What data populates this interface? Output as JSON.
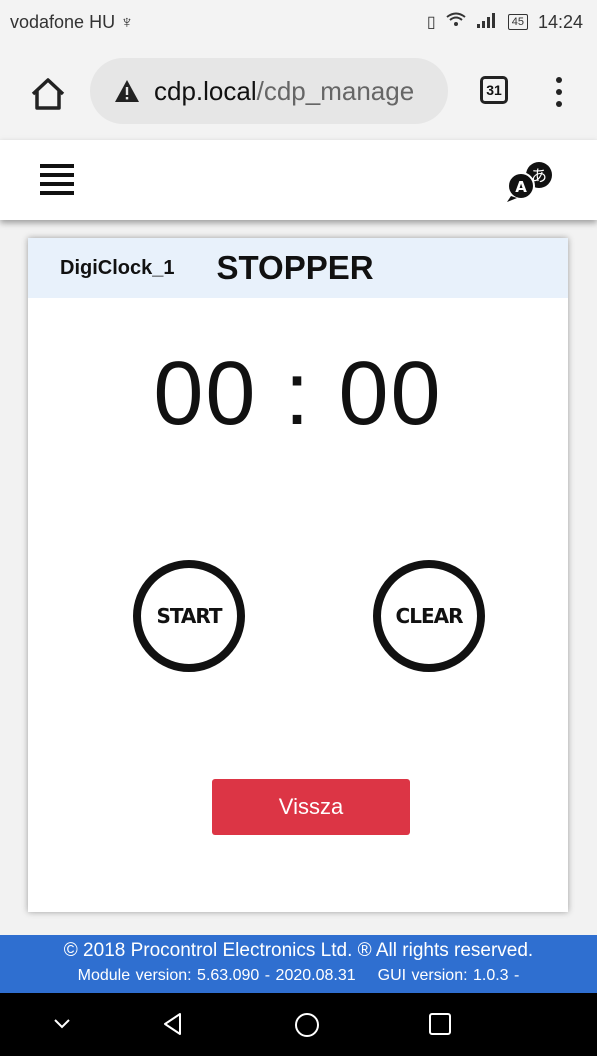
{
  "status_bar": {
    "carrier": "vodafone HU",
    "usb_icon": "usb-icon",
    "battery": "45",
    "time": "14:24"
  },
  "browser": {
    "url_host": "cdp.local",
    "url_path": "/cdp_manage",
    "tab_count": "31"
  },
  "app": {
    "menu_icon": "hamburger-icon",
    "language_icon": "translate-icon"
  },
  "card": {
    "device_name": "DigiClock_1",
    "title": "STOPPER",
    "timer_value": "00 : 00",
    "start_label": "START",
    "clear_label": "CLEAR",
    "back_label": "Vissza"
  },
  "footer": {
    "copyright": "© 2018 Procontrol Electronics Ltd. ® All rights reserved.",
    "module_version": "Module version: 5.63.090 - 2020.08.31",
    "gui_version": "GUI version: 1.0.3 -"
  },
  "colors": {
    "footer_bg": "#2f6fd0",
    "back_button": "#dc3545",
    "card_header_bg": "#e8f1fb"
  }
}
